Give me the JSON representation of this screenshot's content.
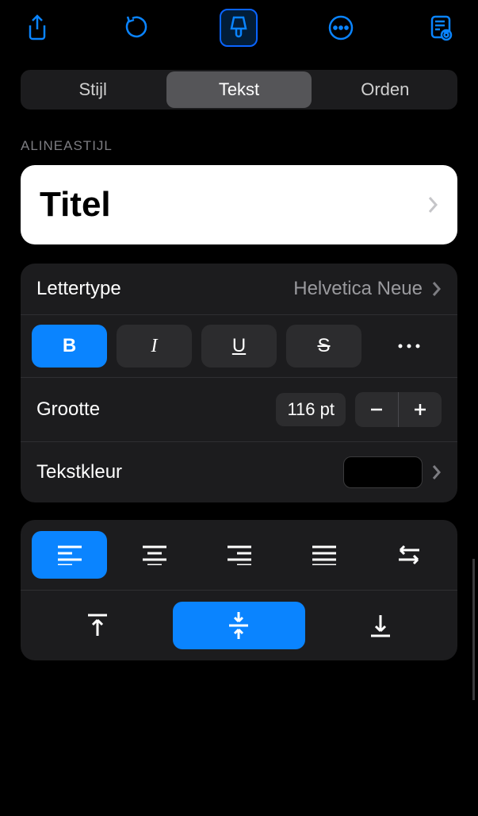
{
  "toolbar": {
    "icons": [
      "share-icon",
      "undo-icon",
      "brush-icon",
      "more-icon",
      "presenter-icon"
    ],
    "active_index": 2
  },
  "tabs": {
    "items": [
      "Stijl",
      "Tekst",
      "Orden"
    ],
    "active_index": 1
  },
  "section": {
    "label": "ALINEASTIJL"
  },
  "paragraph_style": {
    "value": "Titel"
  },
  "font": {
    "label": "Lettertype",
    "value": "Helvetica Neue"
  },
  "styles": {
    "bold": "B",
    "italic": "I",
    "underline": "U",
    "strike": "S",
    "more": "···",
    "active": "bold"
  },
  "size": {
    "label": "Grootte",
    "value": "116 pt"
  },
  "text_color": {
    "label": "Tekstkleur",
    "value": "#000000"
  },
  "align_h": {
    "active_index": 0
  },
  "align_v": {
    "active_index": 1
  }
}
